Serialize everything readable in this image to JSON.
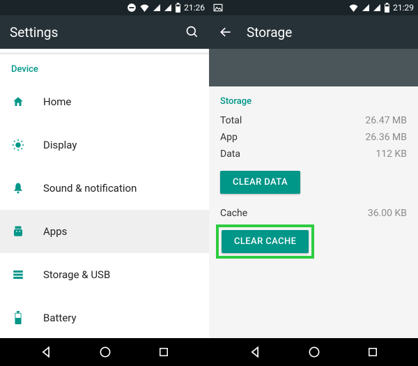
{
  "colors": {
    "teal": "#009688",
    "appbar": "#273238",
    "status": "#1b2529",
    "highlight": "#2ecc40"
  },
  "left": {
    "status_time": "21:26",
    "title": "Settings",
    "section": "Device",
    "items": [
      {
        "icon": "home-icon",
        "label": "Home",
        "selected": false
      },
      {
        "icon": "display-icon",
        "label": "Display",
        "selected": false
      },
      {
        "icon": "bell-icon",
        "label": "Sound & notification",
        "selected": false
      },
      {
        "icon": "apps-icon",
        "label": "Apps",
        "selected": true
      },
      {
        "icon": "storage-icon",
        "label": "Storage & USB",
        "selected": false
      },
      {
        "icon": "battery-icon",
        "label": "Battery",
        "selected": false
      }
    ]
  },
  "right": {
    "status_time": "21:29",
    "title": "Storage",
    "section": "Storage",
    "rows": {
      "total_label": "Total",
      "total_value": "26.47 MB",
      "app_label": "App",
      "app_value": "26.36 MB",
      "data_label": "Data",
      "data_value": "112 KB",
      "cache_label": "Cache",
      "cache_value": "36.00 KB"
    },
    "clear_data_label": "CLEAR DATA",
    "clear_cache_label": "CLEAR CACHE"
  }
}
